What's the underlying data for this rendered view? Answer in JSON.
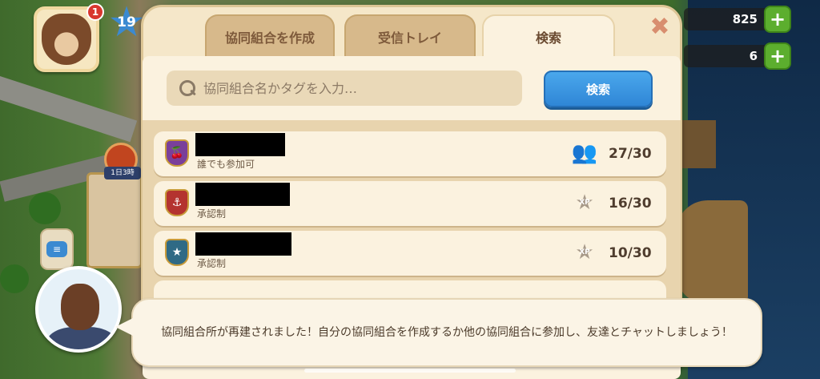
{
  "hud": {
    "notification_count": "1",
    "player_level": "19",
    "currencies": [
      {
        "amount": "825"
      },
      {
        "amount": "6"
      }
    ],
    "timer_label": "1日3時"
  },
  "dialog": {
    "tabs": [
      {
        "label": "協同組合を作成",
        "active": false
      },
      {
        "label": "受信トレイ",
        "active": false
      },
      {
        "label": "検索",
        "active": true
      }
    ],
    "close_label": "✖",
    "search": {
      "placeholder": "協同組合名かタグを入力…",
      "button_label": "検索"
    },
    "coops": [
      {
        "requirement": "誰でも参加可",
        "icon": "members-icon",
        "count": "27/30",
        "emblem_color": "#7a3f9a",
        "emblem_glyph": "🍒"
      },
      {
        "requirement": "承認制",
        "icon": "xp-star-icon",
        "count": "16/30",
        "emblem_color": "#b4332f",
        "emblem_glyph": "⚓"
      },
      {
        "requirement": "承認制",
        "icon": "xp-star-icon",
        "count": "10/30",
        "emblem_color": "#2f6a85",
        "emblem_glyph": "★"
      }
    ]
  },
  "speech": {
    "text": "協同組合所が再建されました！自分の協同組合を作成するか他の協同組合に参加し、友達とチャットしましょう！"
  }
}
